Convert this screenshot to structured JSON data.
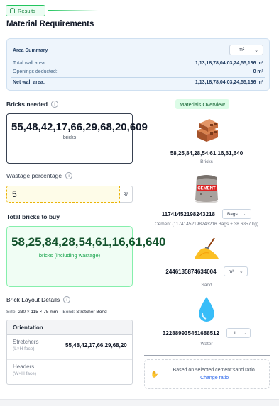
{
  "header": {
    "results_label": "Results",
    "title": "Material Requirements"
  },
  "area_summary": {
    "title": "Area Summary",
    "unit": "m²",
    "rows": [
      {
        "label": "Total wall area:",
        "value": "1,13,18,78,04,03,24,55,136 m²"
      },
      {
        "label": "Openings deducted:",
        "value": "0 m²"
      }
    ],
    "net": {
      "label": "Net wall area:",
      "value": "1,13,18,78,04,03,24,55,136 m²"
    }
  },
  "bricks_needed": {
    "label": "Bricks needed",
    "value": "55,48,42,17,66,29,68,20,609",
    "unit": "bricks"
  },
  "wastage": {
    "label": "Wastage percentage",
    "value": "5",
    "unit": "%"
  },
  "total_bricks": {
    "label": "Total bricks to buy",
    "value": "58,25,84,28,54,61,16,61,640",
    "unit": "bricks (including wastage)"
  },
  "layout": {
    "label": "Brick Layout Details",
    "size_label": "Size:",
    "size_value": "230 × 115 × 75 mm",
    "bond_label": "Bond:",
    "bond_value": "Stretcher Bond",
    "table": {
      "header": "Orientation",
      "rows": [
        {
          "name": "Stretchers",
          "dims": "(L×H face)",
          "value": "55,48,42,17,66,29,68,20"
        },
        {
          "name": "Headers",
          "dims": "(W×H face)",
          "value": ""
        }
      ]
    }
  },
  "overview": {
    "title": "Materials Overview",
    "bricks": {
      "value": "58,25,84,28,54,61,16,61,640",
      "caption": "Bricks"
    },
    "cement": {
      "value": "11741452198243218",
      "unit": "Bags",
      "caption": "Cement (11741452198243216 Bags + 38.6857 kg)",
      "bag_text": "CEMENT"
    },
    "sand": {
      "value": "2446135874634004",
      "unit": "m³",
      "caption": "Sand"
    },
    "water": {
      "value": "322889935451688512",
      "unit": "L",
      "caption": "Water"
    }
  },
  "note": {
    "text": "Based on selected cement:sand ratio.",
    "link": "Change ratio"
  },
  "colors": {
    "accent_green": "#22c55e",
    "link_blue": "#2563eb",
    "summary_bg": "#eef5fc"
  }
}
